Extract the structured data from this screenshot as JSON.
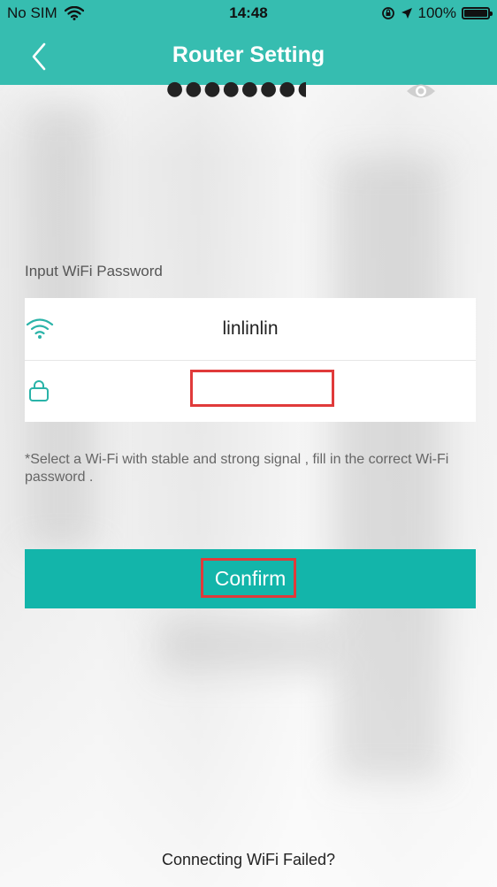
{
  "status_bar": {
    "carrier": "No SIM",
    "time": "14:48",
    "battery_percent": "100%",
    "icons": [
      "wifi-icon",
      "rotation-lock-icon",
      "location-arrow-icon",
      "battery-icon"
    ]
  },
  "nav": {
    "title": "Router Setting",
    "back_icon": "chevron-left-icon"
  },
  "form": {
    "section_label": "Input WiFi Password",
    "ssid": "linlinlin",
    "password_masked": "●●●●●●●●●",
    "ssid_icon": "wifi-icon",
    "password_icon": "lock-icon",
    "visibility_icon": "eye-icon"
  },
  "hint": "*Select a Wi-Fi with stable and strong signal , fill in the correct Wi-Fi password .",
  "confirm_label": "Confirm",
  "failed_link": "Connecting WiFi Failed?",
  "colors": {
    "header": "#36bdb0",
    "accent": "#13b5aa",
    "highlight": "#e03a3a"
  }
}
